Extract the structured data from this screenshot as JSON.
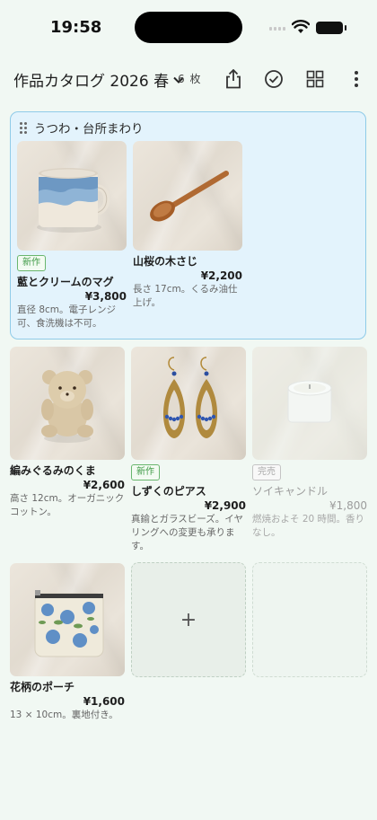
{
  "status": {
    "time": "19:58"
  },
  "header": {
    "title": "作品カタログ 2026 春",
    "count": "6 枚"
  },
  "group": {
    "name": "うつわ・台所まわり",
    "items": [
      {
        "name": "藍とクリームのマグ",
        "price": "¥3,800",
        "badge": "新作",
        "desc": "直径 8cm。電子レンジ可、食洗機は不可。"
      },
      {
        "name": "山桜の木さじ",
        "price": "¥2,200",
        "desc": "長さ 17cm。くるみ油仕上げ。"
      }
    ]
  },
  "items": [
    {
      "name": "編みぐるみのくま",
      "price": "¥2,600",
      "desc": "高さ 12cm。オーガニックコットン。"
    },
    {
      "name": "しずくのピアス",
      "price": "¥2,900",
      "badge": "新作",
      "desc": "真鍮とガラスビーズ。イヤリングへの変更も承ります。"
    },
    {
      "name": "ソイキャンドル",
      "price": "¥1,800",
      "badge": "完売",
      "desc": "燃焼およそ 20 時間。香りなし。"
    },
    {
      "name": "花柄のポーチ",
      "price": "¥1,600",
      "desc": "13 × 10cm。裏地付き。"
    }
  ],
  "add_slot": {
    "label": "+"
  },
  "colors": {
    "accent_green": "#3f9a46",
    "group_bg": "#e3f3fc",
    "group_border": "#8fcbe8",
    "page_bg": "#f1f8f3"
  }
}
